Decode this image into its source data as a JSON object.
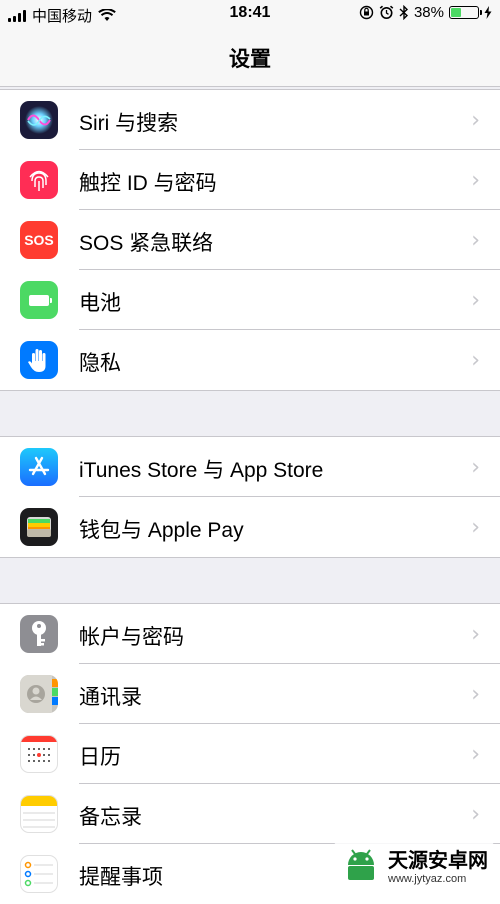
{
  "status": {
    "carrier": "中国移动",
    "time": "18:41",
    "battery": "38%",
    "battery_level": 0.38
  },
  "nav": {
    "title": "设置"
  },
  "groups": [
    {
      "items": [
        {
          "label": "Siri 与搜索",
          "icon": "siri-icon"
        },
        {
          "label": "触控 ID 与密码",
          "icon": "fingerprint-icon"
        },
        {
          "label": "SOS 紧急联络",
          "icon": "sos-icon",
          "icon_text": "SOS"
        },
        {
          "label": "电池",
          "icon": "battery-icon"
        },
        {
          "label": "隐私",
          "icon": "hand-icon"
        }
      ]
    },
    {
      "items": [
        {
          "label": "iTunes Store 与 App Store",
          "icon": "app-store-icon"
        },
        {
          "label": "钱包与 Apple Pay",
          "icon": "wallet-icon"
        }
      ]
    },
    {
      "items": [
        {
          "label": "帐户与密码",
          "icon": "key-icon"
        },
        {
          "label": "通讯录",
          "icon": "contacts-icon"
        },
        {
          "label": "日历",
          "icon": "calendar-icon"
        },
        {
          "label": "备忘录",
          "icon": "notes-icon"
        },
        {
          "label": "提醒事项",
          "icon": "reminders-icon"
        }
      ]
    }
  ],
  "chevron": "›",
  "watermark": {
    "title": "天源安卓网",
    "url": "www.jytyaz.com"
  },
  "colors": {
    "sos": "#ff3b30",
    "touch_id": "#ff2d55",
    "battery": "#4cd964",
    "privacy": "#007aff",
    "app_store": "#1a8cff",
    "key": "#8e8e93"
  }
}
